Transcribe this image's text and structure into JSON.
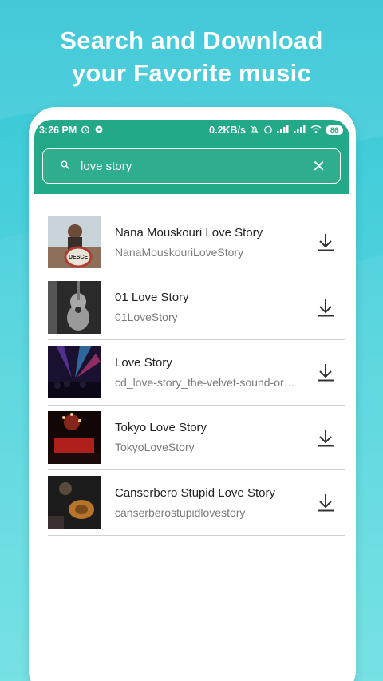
{
  "promo": {
    "line1": "Search and Download",
    "line2": "your Favorite music"
  },
  "status_bar": {
    "time": "3:26 PM",
    "speed": "0.2KB/s",
    "battery": "86"
  },
  "search": {
    "value": "love story",
    "clear_symbol": "✕"
  },
  "results": [
    {
      "title": "Nana Mouskouri Love Story",
      "subtitle": "NanaMouskouriLoveStory"
    },
    {
      "title": "01 Love Story",
      "subtitle": "01LoveStory"
    },
    {
      "title": "Love Story",
      "subtitle": "cd_love-story_the-velvet-sound-orc…"
    },
    {
      "title": "Tokyo Love Story",
      "subtitle": "TokyoLoveStory"
    },
    {
      "title": "Canserbero Stupid Love Story",
      "subtitle": "canserberostupidlovestory"
    }
  ],
  "colors": {
    "accent": "#23a987",
    "background": "#4fd3dd"
  },
  "icons": {
    "search": "search-icon",
    "clear": "close-icon",
    "download": "download-icon"
  }
}
